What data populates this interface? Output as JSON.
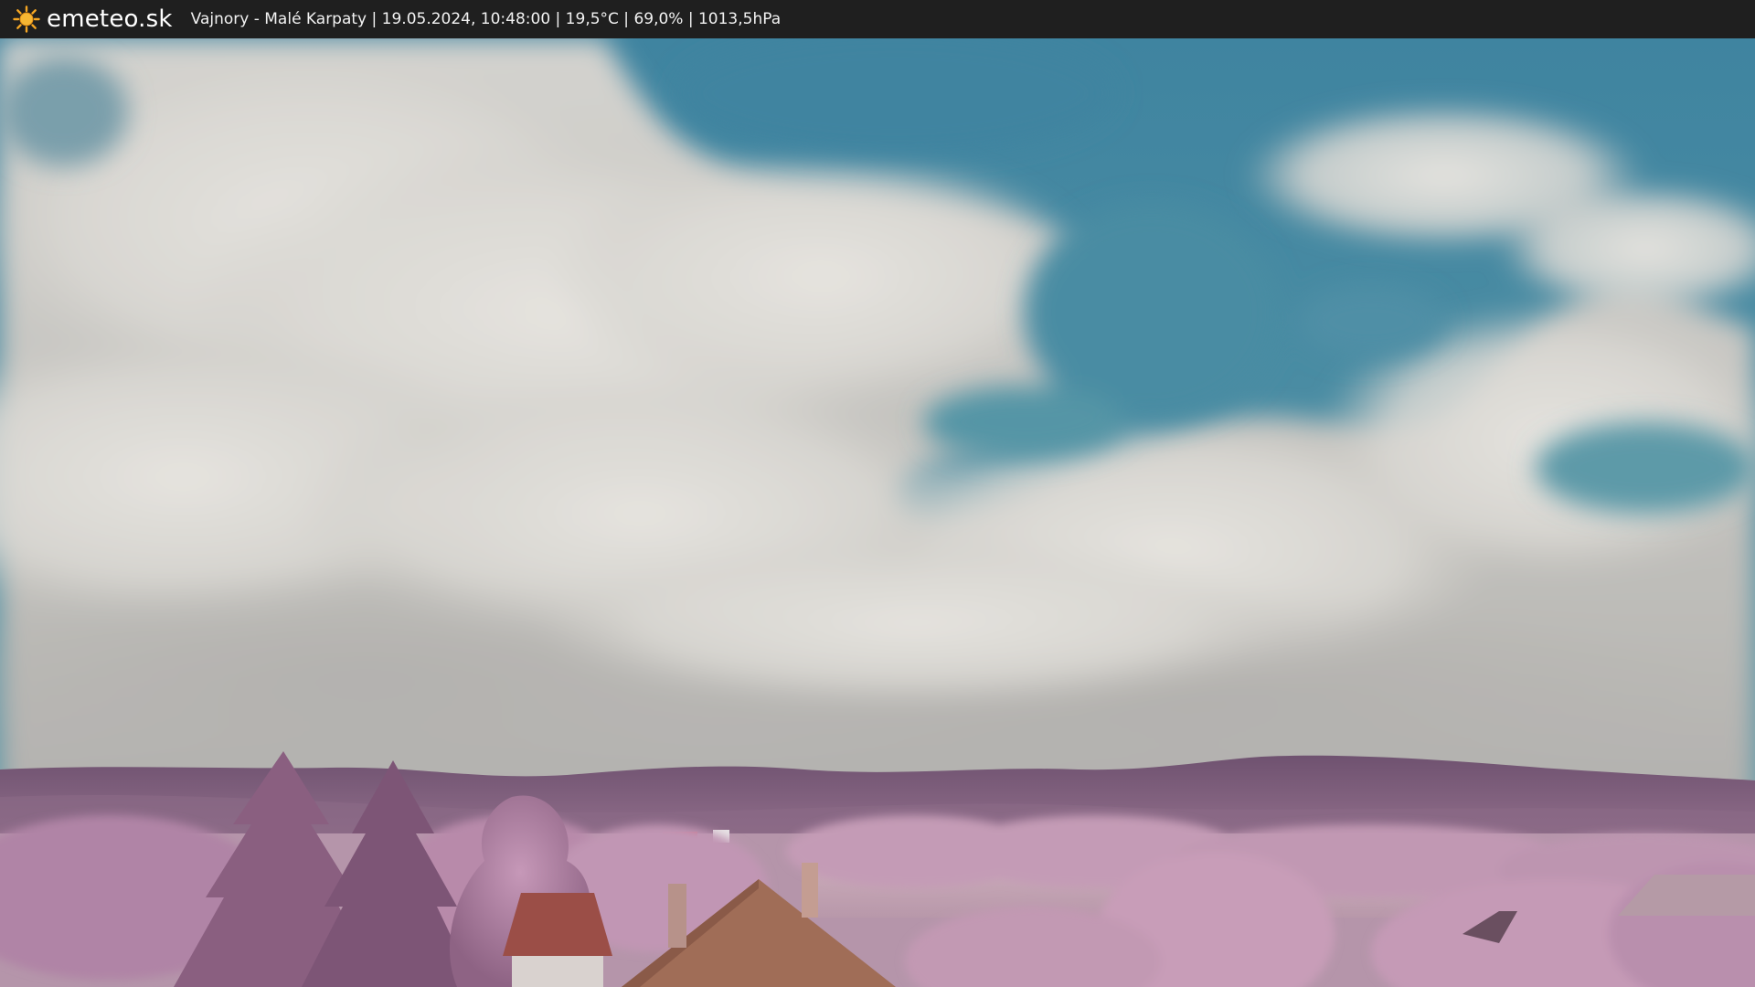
{
  "header": {
    "logo_icon": "sun-icon",
    "brand_name": "emeteo.sk",
    "caption": "Vajnory - Malé Karpaty | 19.05.2024, 10:48:00 | 19,5°C | 69,0% | 1013,5hPa"
  },
  "colors": {
    "bar_background": "#1f1f1f",
    "sun_accent": "#f5a623",
    "sky": "#4f8fa6",
    "cloud": "#d9d7d2",
    "hills": "#7e5f79",
    "foliage": "#b487a8",
    "roof": "#9c6b55"
  }
}
